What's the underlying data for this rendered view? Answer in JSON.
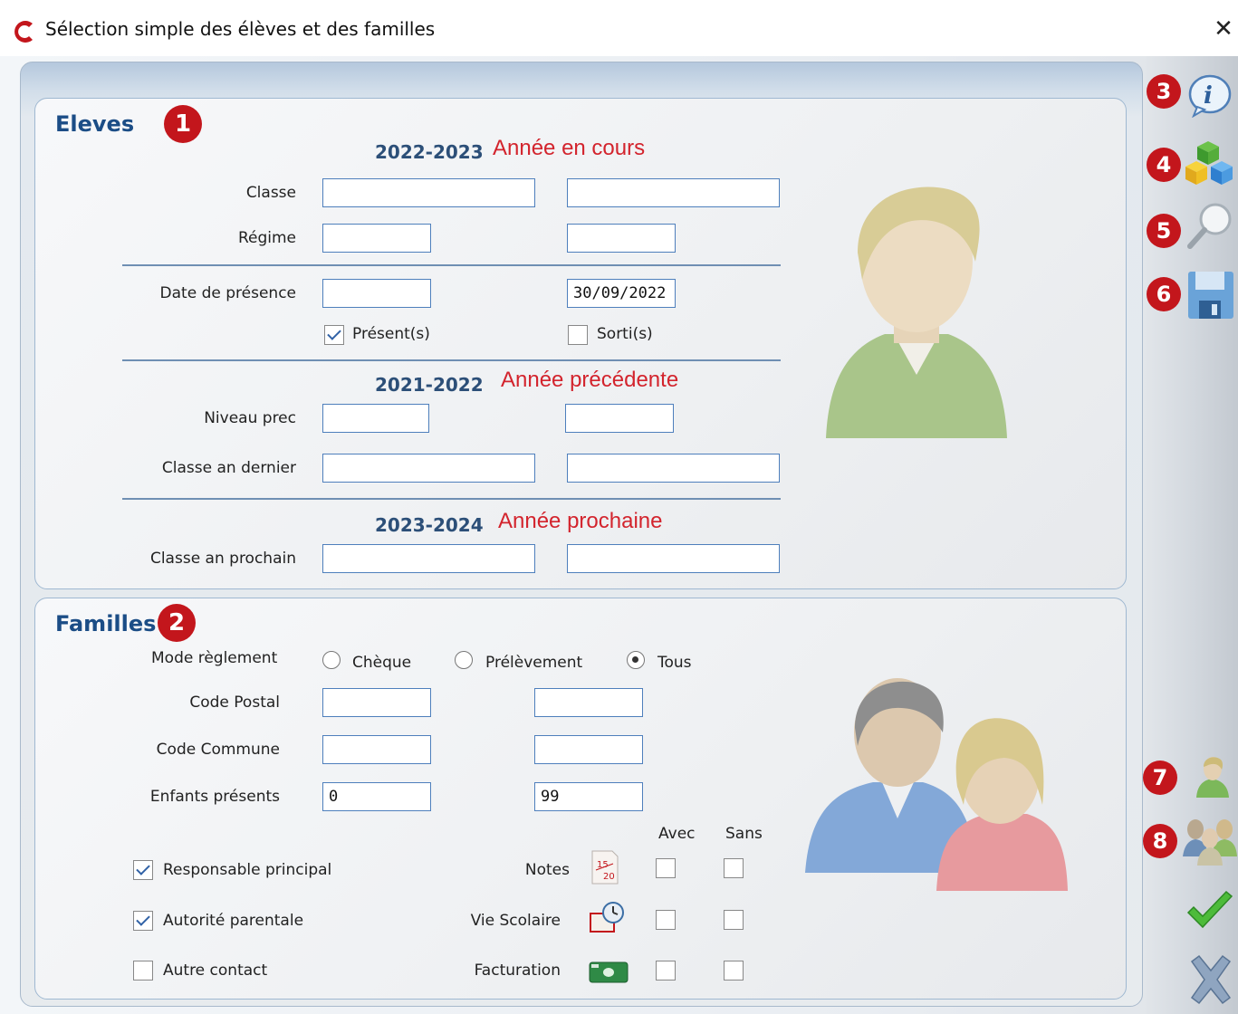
{
  "window": {
    "title": "Sélection simple des élèves et des familles",
    "close_symbol": "✕",
    "logo_letter": "C"
  },
  "eleves": {
    "title": "Eleves",
    "badge": "1",
    "current": {
      "year": "2022-2023",
      "note": "Année en cours",
      "classe_label": "Classe",
      "classe_from": "",
      "classe_to": "",
      "regime_label": "Régime",
      "regime_from": "",
      "regime_to": "",
      "date_label": "Date de présence",
      "date_from": "",
      "date_to": "30/09/2022",
      "present_label": "Présent(s)",
      "present_checked": true,
      "sorti_label": "Sorti(s)",
      "sorti_checked": false
    },
    "previous": {
      "year": "2021-2022",
      "note": "Année précédente",
      "niveau_label": "Niveau prec",
      "niveau_from": "",
      "niveau_to": "",
      "classe_label": "Classe an dernier",
      "classe_from": "",
      "classe_to": ""
    },
    "next": {
      "year": "2023-2024",
      "note": "Année prochaine",
      "classe_label": "Classe an prochain",
      "classe_from": "",
      "classe_to": ""
    }
  },
  "familles": {
    "title": "Familles",
    "badge": "2",
    "mode_label": "Mode règlement",
    "mode_options": [
      "Chèque",
      "Prélèvement",
      "Tous"
    ],
    "mode_selected": "Tous",
    "cp_label": "Code Postal",
    "cp_from": "",
    "cp_to": "",
    "commune_label": "Code Commune",
    "commune_from": "",
    "commune_to": "",
    "enfants_label": "Enfants présents",
    "enfants_from": "0",
    "enfants_to": "99",
    "avec_label": "Avec",
    "sans_label": "Sans",
    "checks": [
      {
        "label": "Responsable principal",
        "checked": true
      },
      {
        "label": "Autorité parentale",
        "checked": true
      },
      {
        "label": "Autre contact",
        "checked": false
      }
    ],
    "filters": [
      {
        "label": "Notes",
        "icon": "notes-icon",
        "avec": false,
        "sans": false
      },
      {
        "label": "Vie Scolaire",
        "icon": "vie-scolaire-icon",
        "avec": false,
        "sans": false
      },
      {
        "label": "Facturation",
        "icon": "facturation-icon",
        "avec": false,
        "sans": false
      }
    ]
  },
  "toolbar": {
    "badges": [
      "3",
      "4",
      "5",
      "6",
      "7",
      "8"
    ],
    "icons": [
      "info-icon",
      "cubes-icon",
      "magnifier-icon",
      "save-icon",
      "student-icon",
      "group-icon",
      "validate-icon",
      "cancel-icon"
    ]
  },
  "colors": {
    "accent_blue": "#1b4d86",
    "note_red": "#d3242d",
    "badge_red": "#c3161c",
    "field_border": "#4e7fbc"
  }
}
